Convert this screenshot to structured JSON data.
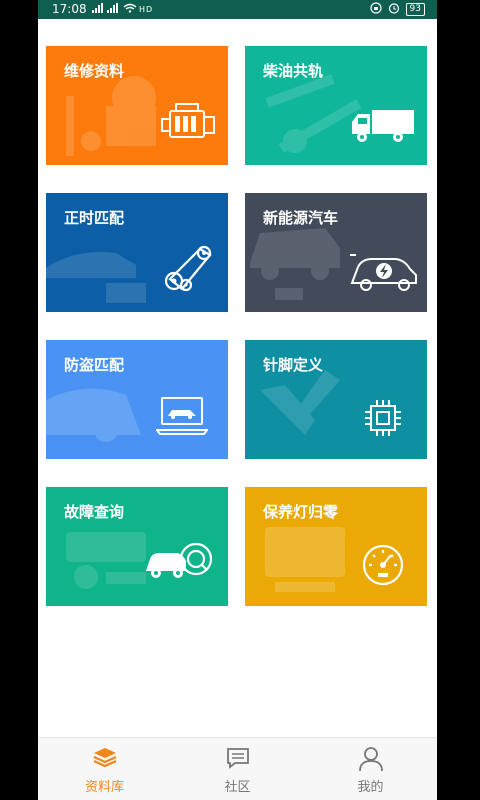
{
  "status_bar": {
    "time": "17:08",
    "signal_text": "ᵢll ᵢll",
    "hd_text": "HD",
    "battery": "93"
  },
  "tiles": [
    {
      "label": "维修资料",
      "color": "#fd7b0c"
    },
    {
      "label": "柴油共轨",
      "color": "#10b69a"
    },
    {
      "label": "正时匹配",
      "color": "#0c5fa6"
    },
    {
      "label": "新能源汽车",
      "color": "#434a5a"
    },
    {
      "label": "防盗匹配",
      "color": "#4a93f4"
    },
    {
      "label": "针脚定义",
      "color": "#0f8fa2"
    },
    {
      "label": "故障查询",
      "color": "#10b48a"
    },
    {
      "label": "保养灯归零",
      "color": "#eaa904"
    }
  ],
  "tabs": [
    {
      "label": "资料库",
      "active": true,
      "icon": "layers-icon",
      "color": "#f0871a"
    },
    {
      "label": "社区",
      "active": false,
      "icon": "chat-icon",
      "color": "#777777"
    },
    {
      "label": "我的",
      "active": false,
      "icon": "person-icon",
      "color": "#777777"
    }
  ]
}
